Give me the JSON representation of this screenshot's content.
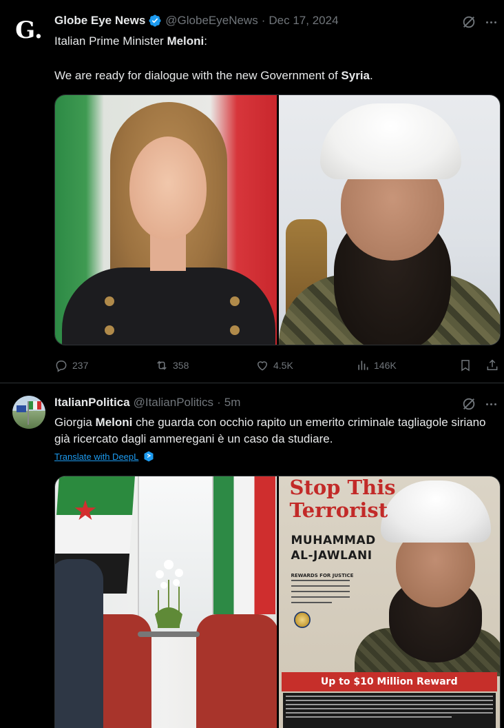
{
  "tweet1": {
    "avatar_letter": "G.",
    "name": "Globe Eye News",
    "handle": "@GlobeEyeNews",
    "separator": "·",
    "time": "Dec 17, 2024",
    "text_prefix": "Italian Prime Minister ",
    "text_bold": "Meloni",
    "text_suffix": ":",
    "text2_prefix": "We are ready for dialogue with the new Government of ",
    "text2_bold": "Syria",
    "text2_suffix": ".",
    "actions": {
      "replies": "237",
      "reposts": "358",
      "likes": "4.5K",
      "views": "146K"
    }
  },
  "tweet2": {
    "name": "ItalianPolitica",
    "handle": "@ItalianPolitics",
    "separator": "·",
    "time": "5m",
    "text_prefix": "Giorgia ",
    "text_bold": "Meloni",
    "text_suffix": " che guarda con occhio rapito un emerito criminale tagliagole siriano già ricercato dagli ammeregani è un caso da studiare.",
    "translate": "Translate with DeepL",
    "poster": {
      "title_line1": "Stop This",
      "title_line2": "Terrorist",
      "name_line1": "MUHAMMAD",
      "name_line2": "AL-JAWLANI",
      "rfj": "REWARDS FOR JUSTICE",
      "reward": "Up to $10 Million Reward"
    }
  },
  "colors": {
    "background": "#000000",
    "text": "#e7e9ea",
    "muted": "#71767b",
    "accent": "#1d9bf0",
    "divider": "#2f3336"
  }
}
